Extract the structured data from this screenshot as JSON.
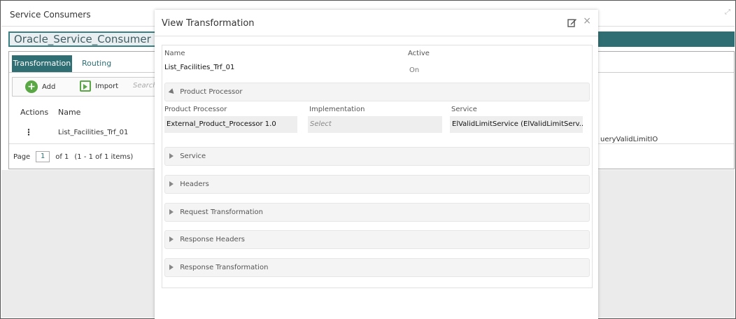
{
  "background": {
    "title": "Service Consumers",
    "breadcrumb": "Oracle_Service_Consumer",
    "tabs": [
      {
        "label": "Transformation"
      },
      {
        "label": "Routing"
      }
    ],
    "toolbar": {
      "add_label": "Add",
      "import_label": "Import",
      "search_placeholder": "Search"
    },
    "columns": [
      "Actions",
      "Name"
    ],
    "row": {
      "actions": "⋮",
      "name": "List_Facilities_Trf_01",
      "extra": "ueryValidLimitIO"
    },
    "pager": {
      "page_label": "Page",
      "page": "1",
      "of_label": "of 1",
      "summary": "(1 - 1 of 1 items)"
    }
  },
  "modal": {
    "title": "View Transformation",
    "name_label": "Name",
    "name_value": "List_Facilities_Trf_01",
    "active_label": "Active",
    "active_value": "On",
    "product_processor_section": "Product Processor",
    "pp_label": "Product Processor",
    "pp_value": "External_Product_Processor 1.0",
    "impl_label": "Implementation",
    "impl_value": "Select",
    "service_label": "Service",
    "service_value": "ElValidLimitService (ElValidLimitServ...",
    "sections": [
      {
        "label": "Service"
      },
      {
        "label": "Headers"
      },
      {
        "label": "Request Transformation"
      },
      {
        "label": "Response Headers"
      },
      {
        "label": "Response Transformation"
      }
    ]
  },
  "colors": {
    "accent": "#2f6f73",
    "add_green": "#5aa845",
    "overlay": "#ebebeb"
  }
}
